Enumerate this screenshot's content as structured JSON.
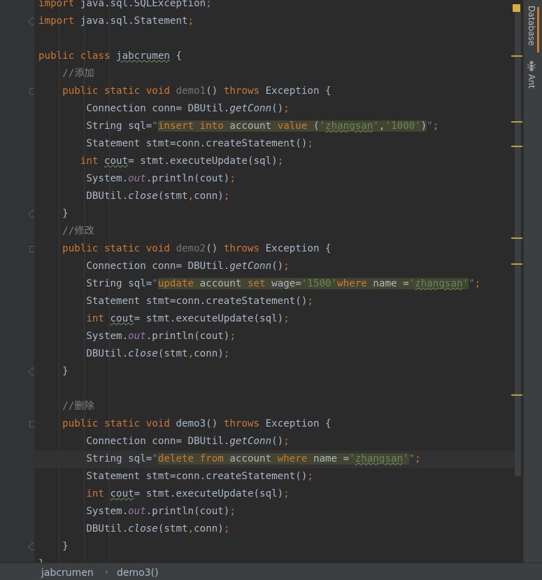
{
  "editor": {
    "lines": [
      {
        "id": "l0",
        "parts": [
          [
            "kw",
            "import "
          ],
          [
            "",
            "java.sql.SQLException"
          ],
          [
            "semi",
            ";"
          ]
        ]
      },
      {
        "id": "l1",
        "parts": [
          [
            "kw",
            "import "
          ],
          [
            "",
            "java.sql.Statement"
          ],
          [
            "semi",
            ";"
          ]
        ]
      },
      {
        "id": "l2",
        "parts": []
      },
      {
        "id": "l3",
        "parts": [
          [
            "kw",
            "public class "
          ],
          [
            "underline-gray",
            "jabcrumen"
          ],
          [
            "",
            " {"
          ]
        ]
      },
      {
        "id": "l4",
        "parts": [
          [
            "",
            "    "
          ],
          [
            "cmt",
            "//添加"
          ]
        ]
      },
      {
        "id": "l5",
        "parts": [
          [
            "",
            "    "
          ],
          [
            "kw",
            "public static void "
          ],
          [
            "unused",
            "demo1"
          ],
          [
            "",
            "() "
          ],
          [
            "kw",
            "throws "
          ],
          [
            "",
            "Exception {"
          ]
        ]
      },
      {
        "id": "l6",
        "parts": [
          [
            "",
            "        Connection conn= DBUtil."
          ],
          [
            "ital",
            "getConn"
          ],
          [
            "",
            "()"
          ],
          [
            "semi",
            ";"
          ]
        ]
      },
      {
        "id": "l7",
        "parts": [
          [
            "",
            "        String sql="
          ],
          [
            "str",
            "\""
          ],
          [
            "sqlbg-kw",
            "insert into "
          ],
          [
            "sqlbg-id",
            "account "
          ],
          [
            "sqlbg-kw",
            "value "
          ],
          [
            "sqlbg-id",
            "("
          ],
          [
            "sqlbg-str",
            "'"
          ],
          [
            "sqlbg-strU",
            "zhangsan"
          ],
          [
            "sqlbg-str",
            "'"
          ],
          [
            "sqlbg-id",
            ","
          ],
          [
            "sqlbg-str",
            "'1000'"
          ],
          [
            "sqlbg-id",
            ")"
          ],
          [
            "str",
            "\""
          ],
          [
            "semi",
            ";"
          ]
        ]
      },
      {
        "id": "l8",
        "parts": [
          [
            "",
            "        Statement stmt=conn.createStatement()"
          ],
          [
            "semi",
            ";"
          ]
        ]
      },
      {
        "id": "l9",
        "parts": [
          [
            "",
            "       "
          ],
          [
            "kw",
            "int "
          ],
          [
            "underline-gray",
            "cout"
          ],
          [
            "",
            "= stmt.executeUpdate(sql)"
          ],
          [
            "semi",
            ";"
          ]
        ]
      },
      {
        "id": "l10",
        "parts": [
          [
            "",
            "        System."
          ],
          [
            "field",
            "out"
          ],
          [
            "",
            ".println(cout)"
          ],
          [
            "semi",
            ";"
          ]
        ]
      },
      {
        "id": "l11",
        "parts": [
          [
            "",
            "        DBUtil."
          ],
          [
            "ital",
            "close"
          ],
          [
            "",
            "(stmt"
          ],
          [
            "semi",
            ","
          ],
          [
            "",
            "conn)"
          ],
          [
            "semi",
            ";"
          ]
        ]
      },
      {
        "id": "l12",
        "parts": [
          [
            "",
            "    }"
          ]
        ]
      },
      {
        "id": "l13",
        "parts": [
          [
            "",
            "    "
          ],
          [
            "cmt",
            "//修改"
          ]
        ]
      },
      {
        "id": "l14",
        "parts": [
          [
            "",
            "    "
          ],
          [
            "kw",
            "public static void "
          ],
          [
            "unused",
            "demo2"
          ],
          [
            "",
            "() "
          ],
          [
            "kw",
            "throws "
          ],
          [
            "",
            "Exception {"
          ]
        ]
      },
      {
        "id": "l15",
        "parts": [
          [
            "",
            "        Connection conn= DBUtil."
          ],
          [
            "ital",
            "getConn"
          ],
          [
            "",
            "()"
          ],
          [
            "semi",
            ";"
          ]
        ]
      },
      {
        "id": "l16",
        "parts": [
          [
            "",
            "        String sql="
          ],
          [
            "str",
            "\""
          ],
          [
            "sqlbg-kw",
            "update "
          ],
          [
            "sqlbg-id",
            "account "
          ],
          [
            "sqlbg-kw",
            "set "
          ],
          [
            "sqlbg-id",
            "wage="
          ],
          [
            "sqlbg-str",
            "'1500'"
          ],
          [
            "sqlbg-kw",
            "where "
          ],
          [
            "sqlbg-id",
            "name ="
          ],
          [
            "sqlbg-str",
            "'"
          ],
          [
            "sqlbg-strU",
            "zhangsan"
          ],
          [
            "sqlbg-str",
            "'"
          ],
          [
            "str",
            "\""
          ],
          [
            "semi",
            ";"
          ]
        ]
      },
      {
        "id": "l17",
        "parts": [
          [
            "",
            "        Statement stmt=conn.createStatement()"
          ],
          [
            "semi",
            ";"
          ]
        ]
      },
      {
        "id": "l18",
        "parts": [
          [
            "",
            "        "
          ],
          [
            "kw",
            "int "
          ],
          [
            "underline-gray",
            "cout"
          ],
          [
            "",
            "= stmt.executeUpdate(sql)"
          ],
          [
            "semi",
            ";"
          ]
        ]
      },
      {
        "id": "l19",
        "parts": [
          [
            "",
            "        System."
          ],
          [
            "field",
            "out"
          ],
          [
            "",
            ".println(cout)"
          ],
          [
            "semi",
            ";"
          ]
        ]
      },
      {
        "id": "l20",
        "parts": [
          [
            "",
            "        DBUtil."
          ],
          [
            "ital",
            "close"
          ],
          [
            "",
            "(stmt"
          ],
          [
            "semi",
            ","
          ],
          [
            "",
            "conn)"
          ],
          [
            "semi",
            ";"
          ]
        ]
      },
      {
        "id": "l21",
        "parts": [
          [
            "",
            "    }"
          ]
        ]
      },
      {
        "id": "l22",
        "parts": []
      },
      {
        "id": "l23",
        "parts": [
          [
            "",
            "    "
          ],
          [
            "cmt",
            "//删除"
          ]
        ]
      },
      {
        "id": "l24",
        "parts": [
          [
            "",
            "    "
          ],
          [
            "kw",
            "public static void "
          ],
          [
            "",
            "demo3() "
          ],
          [
            "kw",
            "throws "
          ],
          [
            "",
            "Exception {"
          ]
        ]
      },
      {
        "id": "l25",
        "parts": [
          [
            "",
            "        Connection conn= DBUtil."
          ],
          [
            "ital",
            "getConn"
          ],
          [
            "",
            "()"
          ],
          [
            "semi",
            ";"
          ]
        ]
      },
      {
        "id": "l26",
        "parts": [
          [
            "",
            "        String sql="
          ],
          [
            "str",
            "\""
          ],
          [
            "sqlbg-kw",
            "delete from "
          ],
          [
            "sqlbg-id",
            "account "
          ],
          [
            "sqlbg-kw",
            "where "
          ],
          [
            "sqlbg-id",
            "name ="
          ],
          [
            "sqlbg-str",
            "'"
          ],
          [
            "sqlbg-strU",
            "zhangsan"
          ],
          [
            "sqlbg-str",
            "'"
          ],
          [
            "str",
            "\""
          ],
          [
            "semi",
            ";"
          ]
        ],
        "current": true
      },
      {
        "id": "l27",
        "parts": [
          [
            "",
            "        Statement stmt=conn.createStatement()"
          ],
          [
            "semi",
            ";"
          ]
        ]
      },
      {
        "id": "l28",
        "parts": [
          [
            "",
            "        "
          ],
          [
            "kw",
            "int "
          ],
          [
            "underline-gray",
            "cout"
          ],
          [
            "",
            "= stmt.executeUpdate(sql)"
          ],
          [
            "semi",
            ";"
          ]
        ]
      },
      {
        "id": "l29",
        "parts": [
          [
            "",
            "        System."
          ],
          [
            "field",
            "out"
          ],
          [
            "",
            ".println(cout)"
          ],
          [
            "semi",
            ";"
          ]
        ]
      },
      {
        "id": "l30",
        "parts": [
          [
            "",
            "        DBUtil."
          ],
          [
            "ital",
            "close"
          ],
          [
            "",
            "(stmt"
          ],
          [
            "semi",
            ","
          ],
          [
            "",
            "conn)"
          ],
          [
            "semi",
            ";"
          ]
        ]
      },
      {
        "id": "l31",
        "parts": [
          [
            "",
            "    }"
          ]
        ]
      },
      {
        "id": "l32",
        "parts": [
          [
            "",
            "}"
          ]
        ]
      }
    ]
  },
  "side_tabs": {
    "database": "Database",
    "ant": "Ant"
  },
  "status": {
    "class_crumb": "jabcrumen",
    "method_crumb": "demo3()",
    "separator": "›"
  },
  "colors": {
    "background": "#2b2b2b",
    "keyword": "#cc7832",
    "string": "#6a8759",
    "comment": "#808080",
    "field": "#9876aa",
    "text": "#a9b7c6"
  }
}
